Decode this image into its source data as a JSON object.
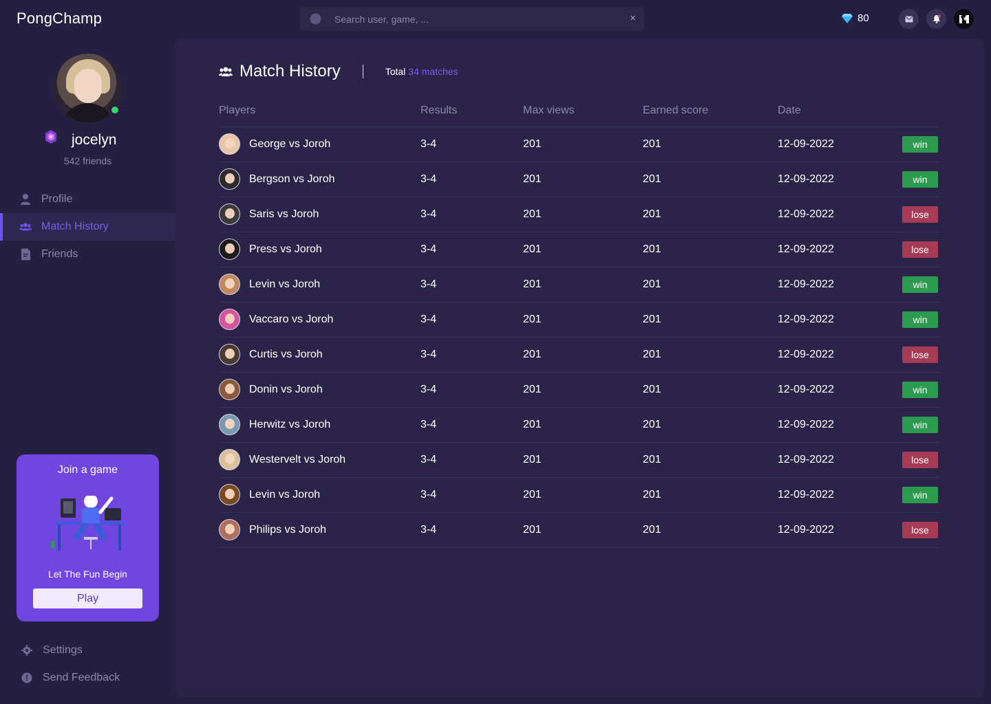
{
  "topbar": {
    "logo": "PongChamp",
    "search_placeholder": "Search user, game, ...",
    "clear_icon": "×",
    "gems": "80"
  },
  "profile": {
    "username": "jocelyn",
    "friends": "542 friends"
  },
  "nav": [
    {
      "label": "Profile",
      "icon": "user-icon"
    },
    {
      "label": "Match History",
      "icon": "users-icon",
      "active": true
    },
    {
      "label": "Friends",
      "icon": "document-icon"
    }
  ],
  "join": {
    "title": "Join a game",
    "subtitle": "Let The Fun Begin",
    "button": "Play"
  },
  "bottom_nav": [
    {
      "label": "Settings",
      "icon": "gear-icon"
    },
    {
      "label": "Send Feedback",
      "icon": "info-icon"
    }
  ],
  "main": {
    "title": "Match History",
    "total_label": "Total",
    "total_value": "34 matches",
    "columns": [
      "Players",
      "Results",
      "Max views",
      "Earned score",
      "Date",
      ""
    ],
    "rows": [
      {
        "players": "George vs Joroh",
        "result": "3-4",
        "views": "201",
        "score": "201",
        "date": "12-09-2022",
        "status": "win",
        "avatar": "#e8c6a8"
      },
      {
        "players": "Bergson vs Joroh",
        "result": "3-4",
        "views": "201",
        "score": "201",
        "date": "12-09-2022",
        "status": "win",
        "avatar": "#2b2b2b"
      },
      {
        "players": "Saris vs Joroh",
        "result": "3-4",
        "views": "201",
        "score": "201",
        "date": "12-09-2022",
        "status": "lose",
        "avatar": "#3a3a3a"
      },
      {
        "players": "Press vs Joroh",
        "result": "3-4",
        "views": "201",
        "score": "201",
        "date": "12-09-2022",
        "status": "lose",
        "avatar": "#1c1c1c"
      },
      {
        "players": "Levin vs Joroh",
        "result": "3-4",
        "views": "201",
        "score": "201",
        "date": "12-09-2022",
        "status": "win",
        "avatar": "#c08a60"
      },
      {
        "players": "Vaccaro vs Joroh",
        "result": "3-4",
        "views": "201",
        "score": "201",
        "date": "12-09-2022",
        "status": "win",
        "avatar": "#d6549c"
      },
      {
        "players": "Curtis vs Joroh",
        "result": "3-4",
        "views": "201",
        "score": "201",
        "date": "12-09-2022",
        "status": "lose",
        "avatar": "#4a3b32"
      },
      {
        "players": "Donin vs Joroh",
        "result": "3-4",
        "views": "201",
        "score": "201",
        "date": "12-09-2022",
        "status": "win",
        "avatar": "#8a5a3a"
      },
      {
        "players": "Herwitz vs Joroh",
        "result": "3-4",
        "views": "201",
        "score": "201",
        "date": "12-09-2022",
        "status": "win",
        "avatar": "#7a9ab0"
      },
      {
        "players": "Westervelt vs Joroh",
        "result": "3-4",
        "views": "201",
        "score": "201",
        "date": "12-09-2022",
        "status": "lose",
        "avatar": "#d9c19e"
      },
      {
        "players": "Levin vs Joroh",
        "result": "3-4",
        "views": "201",
        "score": "201",
        "date": "12-09-2022",
        "status": "win",
        "avatar": "#7a4a22"
      },
      {
        "players": "Philips vs Joroh",
        "result": "3-4",
        "views": "201",
        "score": "201",
        "date": "12-09-2022",
        "status": "lose",
        "avatar": "#b07060"
      }
    ]
  },
  "colors": {
    "accent": "#6e4ff0",
    "win": "#2c9a4f",
    "lose": "#a63b55",
    "online": "#37d46a"
  }
}
